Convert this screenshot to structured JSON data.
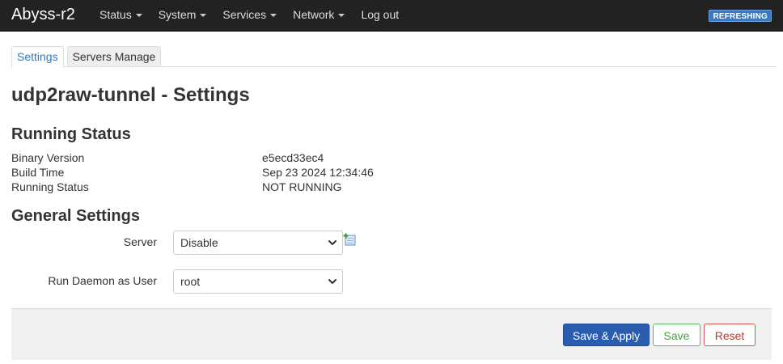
{
  "navbar": {
    "brand": "Abyss-r2",
    "menus": [
      {
        "label": "Status"
      },
      {
        "label": "System"
      },
      {
        "label": "Services"
      },
      {
        "label": "Network"
      }
    ],
    "logout": "Log out",
    "refresh_badge": "REFRESHING"
  },
  "tabs": [
    {
      "label": "Settings",
      "active": true
    },
    {
      "label": "Servers Manage",
      "active": false
    }
  ],
  "page_title": "udp2raw-tunnel - Settings",
  "running_status": {
    "heading": "Running Status",
    "rows": [
      {
        "label": "Binary Version",
        "value": "e5ecd33ec4"
      },
      {
        "label": "Build Time",
        "value": "Sep 23 2024 12:34:46"
      },
      {
        "label": "Running Status",
        "value": "NOT RUNNING"
      }
    ]
  },
  "general_settings": {
    "heading": "General Settings",
    "server": {
      "label": "Server",
      "value": "Disable"
    },
    "daemon_user": {
      "label": "Run Daemon as User",
      "value": "root"
    }
  },
  "actions": {
    "save_apply": "Save & Apply",
    "save": "Save",
    "reset": "Reset"
  },
  "colors": {
    "navbar_bg": "#222222",
    "link": "#337ab7",
    "primary": "#2a5caf",
    "success": "#5cb85c",
    "danger": "#d9534f"
  },
  "icons": {
    "add_server": "add-icon",
    "dropdown": "chevron-down-icon"
  }
}
